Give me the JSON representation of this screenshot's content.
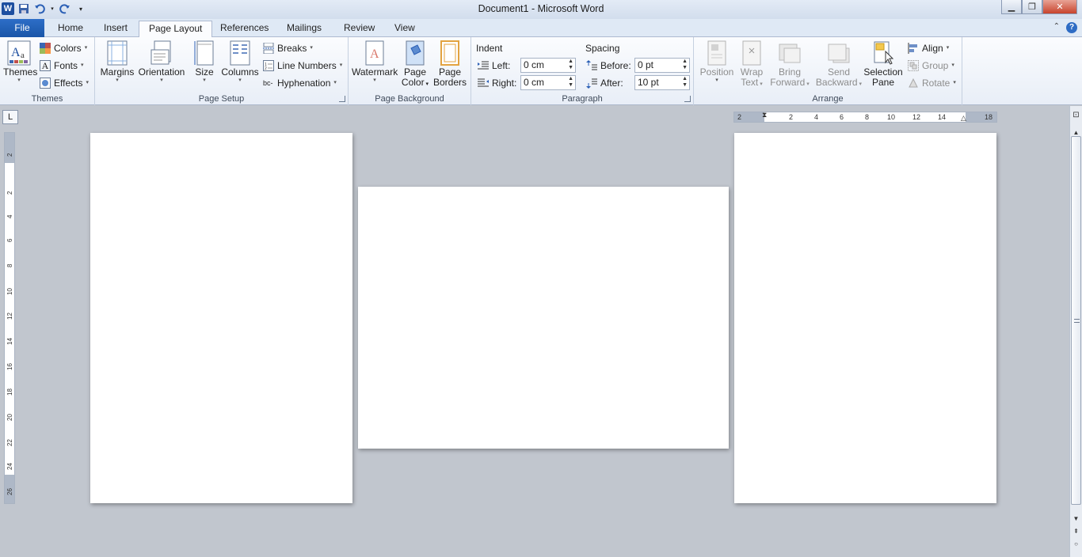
{
  "window": {
    "title": "Document1  -  Microsoft Word",
    "controls": [
      "minimize",
      "restore",
      "close"
    ]
  },
  "quick_access": [
    "save-icon",
    "undo-icon",
    "redo-icon",
    "customize-icon"
  ],
  "tabs": [
    {
      "label": "File"
    },
    {
      "label": "Home"
    },
    {
      "label": "Insert"
    },
    {
      "label": "Page Layout",
      "active": true
    },
    {
      "label": "References"
    },
    {
      "label": "Mailings"
    },
    {
      "label": "Review"
    },
    {
      "label": "View"
    }
  ],
  "ribbon": {
    "themes": {
      "group_label": "Themes",
      "themes_label": "Themes",
      "colors_label": "Colors",
      "fonts_label": "Fonts",
      "effects_label": "Effects"
    },
    "page_setup": {
      "group_label": "Page Setup",
      "margins_label": "Margins",
      "orientation_label": "Orientation",
      "size_label": "Size",
      "columns_label": "Columns",
      "breaks_label": "Breaks",
      "line_numbers_label": "Line Numbers",
      "hyphenation_label": "Hyphenation"
    },
    "page_background": {
      "group_label": "Page Background",
      "watermark_label": "Watermark",
      "page_color_line1": "Page",
      "page_color_line2": "Color",
      "page_borders_line1": "Page",
      "page_borders_line2": "Borders"
    },
    "paragraph": {
      "group_label": "Paragraph",
      "indent_heading": "Indent",
      "left_label": "Left:",
      "left_value": "0 cm",
      "right_label": "Right:",
      "right_value": "0 cm",
      "spacing_heading": "Spacing",
      "before_label": "Before:",
      "before_value": "0 pt",
      "after_label": "After:",
      "after_value": "10 pt"
    },
    "arrange": {
      "group_label": "Arrange",
      "position_label": "Position",
      "wrap_line1": "Wrap",
      "wrap_line2": "Text",
      "bring_line1": "Bring",
      "bring_line2": "Forward",
      "send_line1": "Send",
      "send_line2": "Backward",
      "selection_line1": "Selection",
      "selection_line2": "Pane",
      "align_label": "Align",
      "group_btn_label": "Group",
      "rotate_label": "Rotate"
    }
  },
  "rulers": {
    "horizontal_ticks": [
      "2",
      "2",
      "4",
      "6",
      "8",
      "10",
      "12",
      "14",
      "18"
    ],
    "vertical_ticks": [
      "2",
      "2",
      "4",
      "6",
      "8",
      "10",
      "12",
      "14",
      "16",
      "18",
      "20",
      "22",
      "24",
      "26"
    ],
    "tab_selector": "L"
  },
  "document": {
    "pages": [
      {
        "orientation": "portrait"
      },
      {
        "orientation": "landscape"
      },
      {
        "orientation": "portrait"
      }
    ]
  }
}
